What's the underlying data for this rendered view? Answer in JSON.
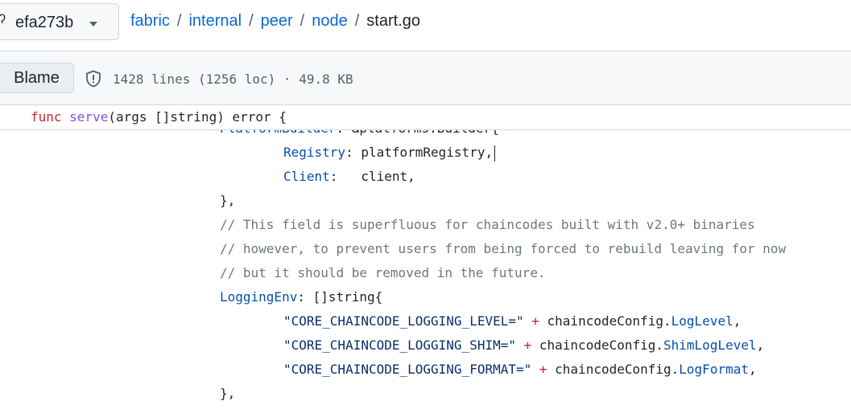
{
  "branch": {
    "label": "efa273b"
  },
  "breadcrumb": {
    "parts": [
      "fabric",
      "internal",
      "peer",
      "node"
    ],
    "file": "start.go",
    "separator": "/"
  },
  "toolbar": {
    "blame_label": "Blame",
    "file_info": "1428 lines (1256 loc) · 49.8 KB"
  },
  "sticky": {
    "kw": "func",
    "name": "serve",
    "rest": "(args []string) error {"
  },
  "code": {
    "l0": {
      "a": "PlatformBuilder",
      "b": ": &platforms.Builder{"
    },
    "l1": {
      "prop": "Registry",
      "rest": ": platformRegistry,"
    },
    "l2": {
      "prop": "Client",
      "rest": ":   client,"
    },
    "l3": {
      "text": "},"
    },
    "l4": {
      "text": "// This field is superfluous for chaincodes built with v2.0+ binaries"
    },
    "l5": {
      "text": "// however, to prevent users from being forced to rebuild leaving for now"
    },
    "l6": {
      "text": "// but it should be removed in the future."
    },
    "l7": {
      "prop": "LoggingEnv",
      "rest": ": []string{"
    },
    "l8": {
      "str": "\"CORE_CHAINCODE_LOGGING_LEVEL=\"",
      "op": " + ",
      "obj": "chaincodeConfig.",
      "field": "LogLevel",
      "end": ","
    },
    "l9": {
      "str": "\"CORE_CHAINCODE_LOGGING_SHIM=\"",
      "op": " + ",
      "obj": "chaincodeConfig.",
      "field": "ShimLogLevel",
      "end": ","
    },
    "l10": {
      "str": "\"CORE_CHAINCODE_LOGGING_FORMAT=\"",
      "op": " + ",
      "obj": "chaincodeConfig.",
      "field": "LogFormat",
      "end": ","
    },
    "l11": {
      "text": "},"
    }
  }
}
